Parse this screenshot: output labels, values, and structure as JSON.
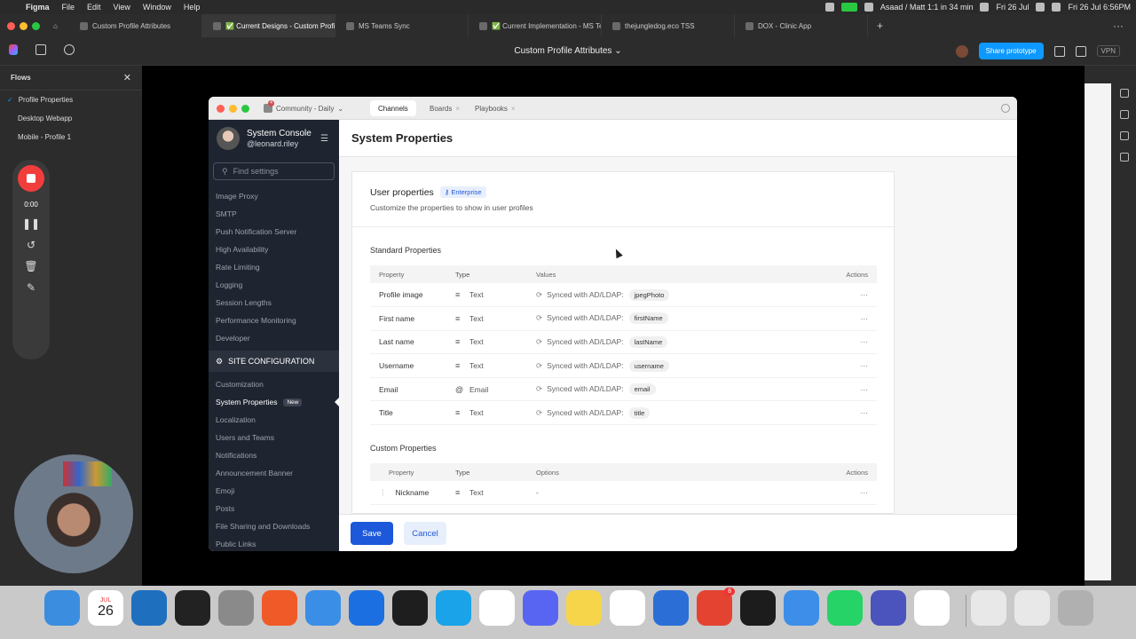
{
  "menubar": {
    "app": "Figma",
    "menus": [
      "File",
      "Edit",
      "View",
      "Window",
      "Help"
    ],
    "call_status": "Asaad / Matt 1:1 in 34 min",
    "date_mid": "Fri 26 Jul",
    "clock": "Fri 26 Jul 6:56PM"
  },
  "figma_tabs": [
    {
      "label": "Custom Profile Attributes",
      "active": false
    },
    {
      "label": "✅ Current Designs - Custom Profi",
      "active": true
    },
    {
      "label": "MS Teams Sync",
      "active": false
    },
    {
      "label": "✅ Current Implementation - MS Tea",
      "active": false
    },
    {
      "label": "thejungledog.eco TSS",
      "active": false
    },
    {
      "label": "DOX - Clinic App",
      "active": false
    }
  ],
  "toolbar": {
    "file_title": "Custom Profile Attributes",
    "share_label": "Share prototype",
    "vpn_label": "VPN"
  },
  "flows": {
    "title": "Flows",
    "items": [
      {
        "label": "Profile Properties",
        "selected": true
      },
      {
        "label": "Desktop Webapp",
        "selected": false
      },
      {
        "label": "Mobile - Profile 1",
        "selected": false
      }
    ]
  },
  "recorder": {
    "time": "0:00",
    "record_color": "#f23d3d"
  },
  "proto": {
    "team": "Community - Daily",
    "team_badge": "4",
    "tabs": [
      {
        "label": "Channels",
        "active": true
      },
      {
        "label": "Boards",
        "active": false
      },
      {
        "label": "Playbooks",
        "active": false
      }
    ]
  },
  "sidebar": {
    "console_title": "System Console",
    "handle": "@leonard.riley",
    "search_placeholder": "Find settings",
    "top_items": [
      "Image Proxy",
      "SMTP",
      "Push Notification Server",
      "High Availability",
      "Rate Limiting",
      "Logging",
      "Session Lengths",
      "Performance Monitoring",
      "Developer"
    ],
    "section": "SITE CONFIGURATION",
    "section_items": [
      {
        "label": "Customization",
        "active": false,
        "badge": ""
      },
      {
        "label": "System Properties",
        "active": true,
        "badge": "New"
      },
      {
        "label": "Localization",
        "active": false,
        "badge": ""
      },
      {
        "label": "Users and Teams",
        "active": false,
        "badge": ""
      },
      {
        "label": "Notifications",
        "active": false,
        "badge": ""
      },
      {
        "label": "Announcement Banner",
        "active": false,
        "badge": ""
      },
      {
        "label": "Emoji",
        "active": false,
        "badge": ""
      },
      {
        "label": "Posts",
        "active": false,
        "badge": ""
      },
      {
        "label": "File Sharing and Downloads",
        "active": false,
        "badge": ""
      },
      {
        "label": "Public Links",
        "active": false,
        "badge": ""
      }
    ]
  },
  "main": {
    "page_title": "System Properties",
    "card_title": "User properties",
    "enterprise_label": "Enterprise",
    "card_subtitle": "Customize the properties to show in user profiles",
    "standard_title": "Standard Properties",
    "standard_headers": {
      "property": "Property",
      "type": "Type",
      "values": "Values",
      "actions": "Actions"
    },
    "standard_rows": [
      {
        "property": "Profile image",
        "type": "Text",
        "type_icon": "≡",
        "sync": "Synced with AD/LDAP:",
        "attr": "jpegPhoto"
      },
      {
        "property": "First name",
        "type": "Text",
        "type_icon": "≡",
        "sync": "Synced with AD/LDAP:",
        "attr": "firstName"
      },
      {
        "property": "Last name",
        "type": "Text",
        "type_icon": "≡",
        "sync": "Synced with AD/LDAP:",
        "attr": "lastName"
      },
      {
        "property": "Username",
        "type": "Text",
        "type_icon": "≡",
        "sync": "Synced with AD/LDAP:",
        "attr": "username"
      },
      {
        "property": "Email",
        "type": "Email",
        "type_icon": "@",
        "sync": "Synced with AD/LDAP:",
        "attr": "email"
      },
      {
        "property": "Title",
        "type": "Text",
        "type_icon": "≡",
        "sync": "Synced with AD/LDAP:",
        "attr": "title"
      }
    ],
    "custom_title": "Custom Properties",
    "custom_headers": {
      "property": "Property",
      "type": "Type",
      "options": "Options",
      "actions": "Actions"
    },
    "custom_rows": [
      {
        "property": "Nickname",
        "type": "Text",
        "type_icon": "≡",
        "options": "-"
      }
    ],
    "actions_glyph": "···",
    "save_label": "Save",
    "cancel_label": "Cancel",
    "accent": "#1c58d9"
  },
  "dock": {
    "calendar_month": "JUL",
    "calendar_day": "26",
    "todoist_badge": "8"
  }
}
